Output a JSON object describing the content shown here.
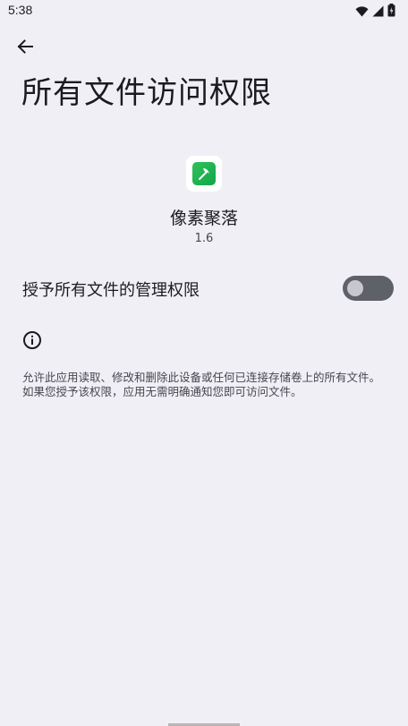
{
  "status_bar": {
    "time": "5:38",
    "icons": [
      "wifi-icon",
      "cell-signal-icon",
      "battery-icon"
    ]
  },
  "header": {
    "back_icon": "arrow-left-icon",
    "title": "所有文件访问权限"
  },
  "app": {
    "icon": "pickaxe-app-icon",
    "name": "像素聚落",
    "version": "1.6"
  },
  "permission": {
    "label": "授予所有文件的管理权限",
    "enabled": false
  },
  "info": {
    "icon": "info-icon",
    "description": "允许此应用读取、修改和删除此设备或任何已连接存储卷上的所有文件。如果您授予该权限，应用无需明确通知您即可访问文件。"
  },
  "colors": {
    "background": "#f0eff5",
    "toggle_off_track": "#5f6168",
    "app_icon_green": "#2fc25a"
  }
}
